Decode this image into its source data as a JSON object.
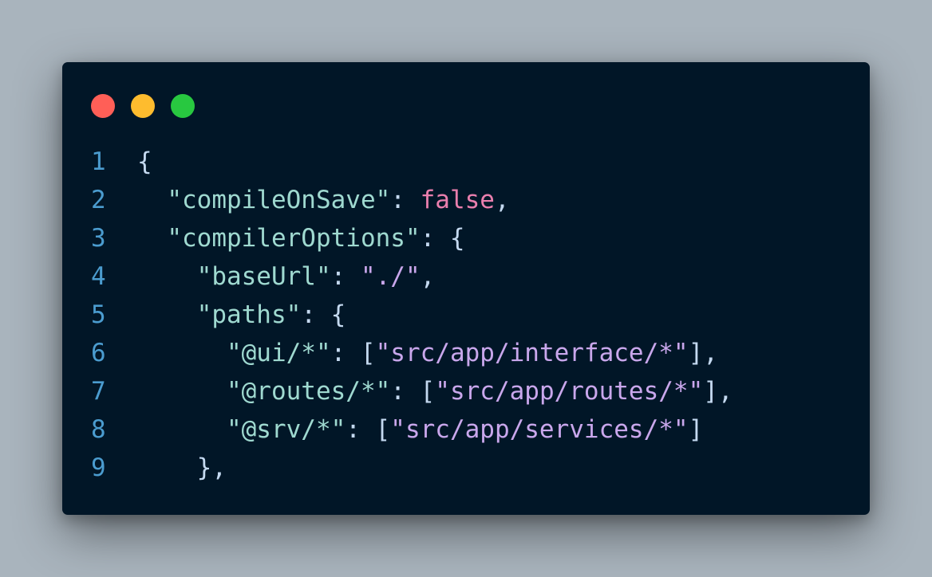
{
  "colors": {
    "background": "#a9b4bd",
    "window": "#011627",
    "close": "#ff5f57",
    "minimize": "#febc2e",
    "maximize": "#28c840",
    "line_number": "#4b9ccf",
    "key": "#9fd9d0",
    "string": "#c9a7ec",
    "boolean": "#ea7fae",
    "punctuation": "#c4d9f0"
  },
  "window_controls": [
    {
      "name": "close-button",
      "color": "#ff5f57"
    },
    {
      "name": "minimize-button",
      "color": "#febc2e"
    },
    {
      "name": "maximize-button",
      "color": "#28c840"
    }
  ],
  "code": {
    "language": "json",
    "lines": [
      {
        "num": "1",
        "indent": "",
        "tokens": [
          {
            "t": "{",
            "k": "punc"
          }
        ]
      },
      {
        "num": "2",
        "indent": "  ",
        "tokens": [
          {
            "t": "\"compileOnSave\"",
            "k": "key"
          },
          {
            "t": ": ",
            "k": "punc"
          },
          {
            "t": "false",
            "k": "bool"
          },
          {
            "t": ",",
            "k": "punc"
          }
        ]
      },
      {
        "num": "3",
        "indent": "  ",
        "tokens": [
          {
            "t": "\"compilerOptions\"",
            "k": "key"
          },
          {
            "t": ": {",
            "k": "punc"
          }
        ]
      },
      {
        "num": "4",
        "indent": "    ",
        "tokens": [
          {
            "t": "\"baseUrl\"",
            "k": "key"
          },
          {
            "t": ": ",
            "k": "punc"
          },
          {
            "t": "\"./\"",
            "k": "str"
          },
          {
            "t": ",",
            "k": "punc"
          }
        ]
      },
      {
        "num": "5",
        "indent": "    ",
        "tokens": [
          {
            "t": "\"paths\"",
            "k": "key"
          },
          {
            "t": ": {",
            "k": "punc"
          }
        ]
      },
      {
        "num": "6",
        "indent": "      ",
        "tokens": [
          {
            "t": "\"@ui/*\"",
            "k": "key"
          },
          {
            "t": ": [",
            "k": "punc"
          },
          {
            "t": "\"src/app/interface/*\"",
            "k": "str"
          },
          {
            "t": "],",
            "k": "punc"
          }
        ]
      },
      {
        "num": "7",
        "indent": "      ",
        "tokens": [
          {
            "t": "\"@routes/*\"",
            "k": "key"
          },
          {
            "t": ": [",
            "k": "punc"
          },
          {
            "t": "\"src/app/routes/*\"",
            "k": "str"
          },
          {
            "t": "],",
            "k": "punc"
          }
        ]
      },
      {
        "num": "8",
        "indent": "      ",
        "tokens": [
          {
            "t": "\"@srv/*\"",
            "k": "key"
          },
          {
            "t": ": [",
            "k": "punc"
          },
          {
            "t": "\"src/app/services/*\"",
            "k": "str"
          },
          {
            "t": "]",
            "k": "punc"
          }
        ]
      },
      {
        "num": "9",
        "indent": "    ",
        "tokens": [
          {
            "t": "},",
            "k": "punc"
          }
        ]
      }
    ]
  }
}
